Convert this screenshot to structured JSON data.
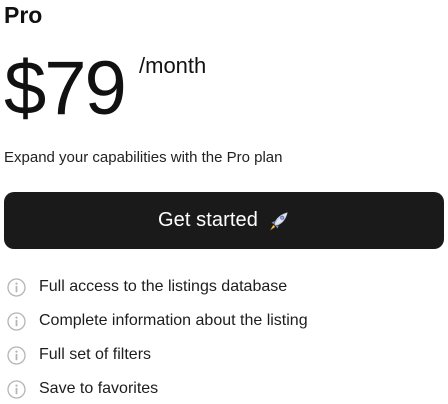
{
  "plan": {
    "name": "Pro",
    "price": "$79",
    "period": "/month",
    "description": "Expand your capabilities with the Pro plan"
  },
  "cta": {
    "label": "Get started",
    "icon": "rocket-icon",
    "background": "#1a1a1b",
    "text_color": "#ffffff"
  },
  "features": [
    {
      "icon": "info-icon",
      "label": "Full access to the listings database"
    },
    {
      "icon": "info-icon",
      "label": "Complete information about the listing"
    },
    {
      "icon": "info-icon",
      "label": "Full set of filters"
    },
    {
      "icon": "info-icon",
      "label": "Save to favorites"
    }
  ]
}
